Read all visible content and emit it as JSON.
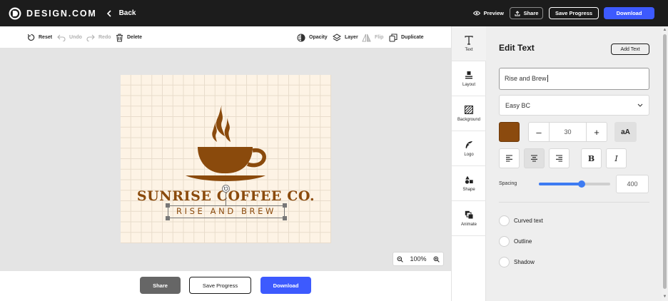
{
  "header": {
    "brand": "DESIGN.COM",
    "back_label": "Back",
    "preview_label": "Preview",
    "share_label": "Share",
    "save_label": "Save Progress",
    "download_label": "Download"
  },
  "toolbar": {
    "reset": "Reset",
    "undo": "Undo",
    "redo": "Redo",
    "delete": "Delete",
    "opacity": "Opacity",
    "layer": "Layer",
    "flip": "Flip",
    "duplicate": "Duplicate"
  },
  "canvas": {
    "title": "SUNRISE COFFEE CO.",
    "tagline": "RISE AND BREW",
    "zoom": "100%",
    "colors": {
      "brand": "#8a4a0c",
      "artboard": "#fdf3e5"
    }
  },
  "bottom": {
    "share_label": "Share",
    "save_label": "Save Progress",
    "download_label": "Download"
  },
  "side_tabs": [
    {
      "label": "Text",
      "icon": "text-icon"
    },
    {
      "label": "Layout",
      "icon": "layout-icon"
    },
    {
      "label": "Background",
      "icon": "background-icon"
    },
    {
      "label": "Logo",
      "icon": "logo-icon"
    },
    {
      "label": "Shape",
      "icon": "shape-icon"
    },
    {
      "label": "Animate",
      "icon": "animate-icon"
    }
  ],
  "panel": {
    "title": "Edit Text",
    "add_text_label": "Add Text",
    "text_value": "Rise and Brew",
    "font_value": "Easy BC",
    "color": "#8b4a0e",
    "size_value": "30",
    "case_label": "aA",
    "bold_label": "B",
    "italic_label": "I",
    "spacing_label": "Spacing",
    "spacing_value": "400",
    "spacing_fraction": 0.6,
    "options": [
      "Curved text",
      "Outline",
      "Shadow"
    ]
  }
}
